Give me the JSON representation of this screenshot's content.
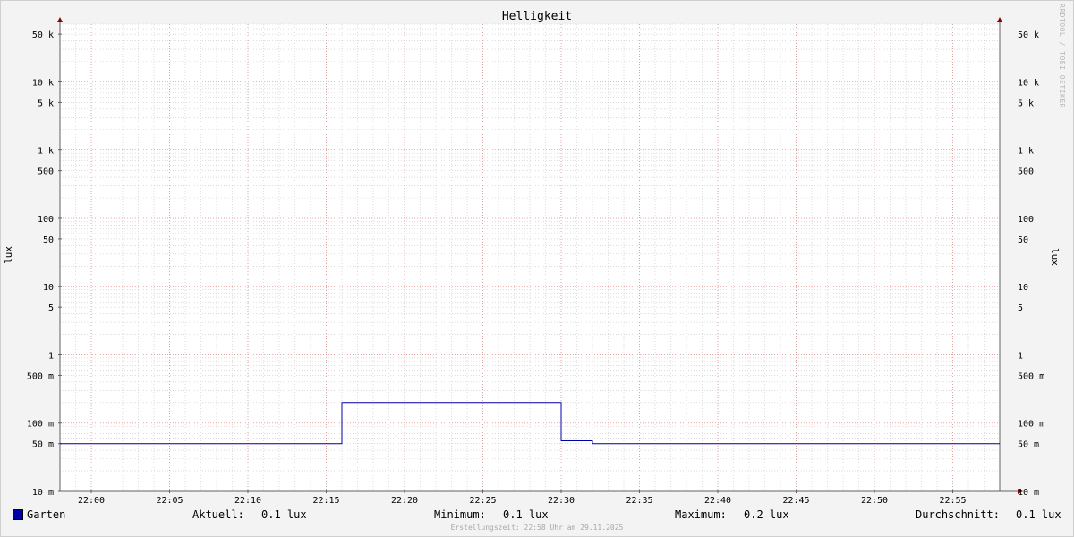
{
  "chart_data": {
    "type": "line",
    "title": "Helligkeit",
    "ylabel": "lux",
    "y_scale": "log",
    "ylim": [
      0.01,
      70000
    ],
    "y_ticks": [
      {
        "value": 50000,
        "label": "50 k"
      },
      {
        "value": 10000,
        "label": "10 k"
      },
      {
        "value": 5000,
        "label": "5 k"
      },
      {
        "value": 1000,
        "label": "1 k"
      },
      {
        "value": 500,
        "label": "500"
      },
      {
        "value": 100,
        "label": "100"
      },
      {
        "value": 50,
        "label": "50"
      },
      {
        "value": 10,
        "label": "10"
      },
      {
        "value": 5,
        "label": "5"
      },
      {
        "value": 1,
        "label": "1"
      },
      {
        "value": 0.5,
        "label": "500 m"
      },
      {
        "value": 0.1,
        "label": "100 m"
      },
      {
        "value": 0.05,
        "label": "50 m"
      },
      {
        "value": 0.01,
        "label": "10 m"
      }
    ],
    "xlim": [
      "21:58",
      "21:58 +60"
    ],
    "x_ticks": [
      "22:00",
      "22:05",
      "22:10",
      "22:15",
      "22:20",
      "22:25",
      "22:30",
      "22:35",
      "22:40",
      "22:45",
      "22:50",
      "22:55"
    ],
    "grid": true,
    "series": [
      {
        "name": "Garten",
        "color": "#0000a8",
        "points": [
          [
            "21:58",
            0.05
          ],
          [
            "22:16",
            0.05
          ],
          [
            "22:16",
            0.2
          ],
          [
            "22:30",
            0.2
          ],
          [
            "22:30",
            0.055
          ],
          [
            "22:32",
            0.055
          ],
          [
            "22:32",
            0.05
          ],
          [
            "22:58",
            0.05
          ]
        ]
      }
    ]
  },
  "legend": {
    "series_name": "Garten",
    "current_label": "Aktuell:",
    "current_value": "0.1 lux",
    "min_label": "Minimum:",
    "min_value": "0.1 lux",
    "max_label": "Maximum:",
    "max_value": "0.2 lux",
    "avg_label": "Durchschnitt:",
    "avg_value": "0.1 lux"
  },
  "watermark": "RRDTOOL / TOBI OETIKER",
  "footer": "Erstellungszeit: 22:58 Uhr am 29.11.2025",
  "colors": {
    "major_grid": "#e08a8a",
    "minor_grid": "#c8c8c8",
    "axis": "#606060",
    "arrow": "#8b0000"
  }
}
